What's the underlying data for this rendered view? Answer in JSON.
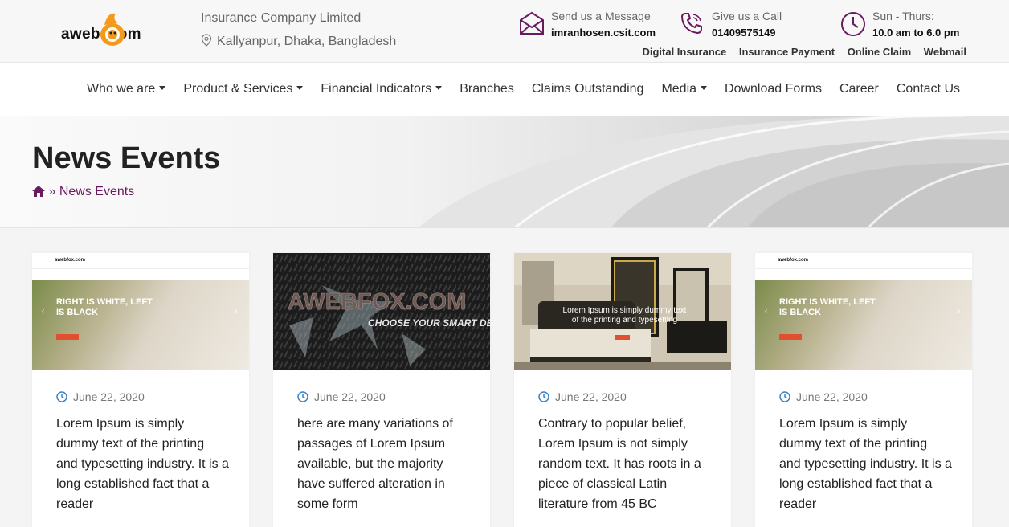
{
  "header": {
    "logo_text": "aweb   .com",
    "company": "Insurance Company Limited",
    "address": "Kallyanpur, Dhaka, Bangladesh",
    "contacts": [
      {
        "icon": "envelope-icon",
        "label": "Send us a Message",
        "value": "imranhosen.csit.com"
      },
      {
        "icon": "phone-icon",
        "label": "Give us a Call",
        "value": "01409575149"
      },
      {
        "icon": "clock-icon",
        "label": "Sun - Thurs:",
        "value": "10.0 am to 6.0 pm"
      }
    ],
    "quick_links": [
      "Digital Insurance",
      "Insurance Payment",
      "Online Claim",
      "Webmail"
    ]
  },
  "nav": {
    "items": [
      {
        "label": "Who we are",
        "dropdown": true
      },
      {
        "label": "Product & Services",
        "dropdown": true
      },
      {
        "label": "Financial Indicators",
        "dropdown": true
      },
      {
        "label": "Branches",
        "dropdown": false
      },
      {
        "label": "Claims Outstanding",
        "dropdown": false
      },
      {
        "label": "Media",
        "dropdown": true
      },
      {
        "label": "Download Forms",
        "dropdown": false
      },
      {
        "label": "Career",
        "dropdown": false
      },
      {
        "label": "Contact Us",
        "dropdown": false
      }
    ]
  },
  "hero": {
    "title": "News Events",
    "breadcrumb_sep": "»",
    "breadcrumb_current": "News Events"
  },
  "cards": [
    {
      "image": "website-slider-thumbnail",
      "image_logo": "awebfox.com",
      "image_headline": "RIGHT IS WHITE, LEFT IS BLACK",
      "date": "June 22, 2020",
      "text": "Lorem Ipsum is simply dummy text of the printing and typesetting industry. It is a long established fact that a reader"
    },
    {
      "image": "awebfox-banner-thumbnail",
      "image_title": "AWEBFOX.COM",
      "image_subtitle": "CHOOSE YOUR SMART DESIGN",
      "date": "June 22, 2020",
      "text": "here are many variations of passages of Lorem Ipsum available, but the majority have suffered alteration in some form"
    },
    {
      "image": "bedroom-slider-thumbnail",
      "image_headline": "Lorem Ipsum is simply dummy text of the printing and typesetting",
      "date": "June 22, 2020",
      "text": "Contrary to popular belief, Lorem Ipsum is not simply random text. It has roots in a piece of classical Latin literature from 45 BC"
    },
    {
      "image": "website-slider-thumbnail",
      "image_logo": "awebfox.com",
      "image_headline": "RIGHT IS WHITE, LEFT IS BLACK",
      "date": "June 22, 2020",
      "text": "Lorem Ipsum is simply dummy text of the printing and typesetting industry. It is a long established fact that a reader"
    }
  ],
  "colors": {
    "accent": "#6a1a5e",
    "date_icon": "#3b82c4",
    "logo_orange": "#f39a1e"
  }
}
